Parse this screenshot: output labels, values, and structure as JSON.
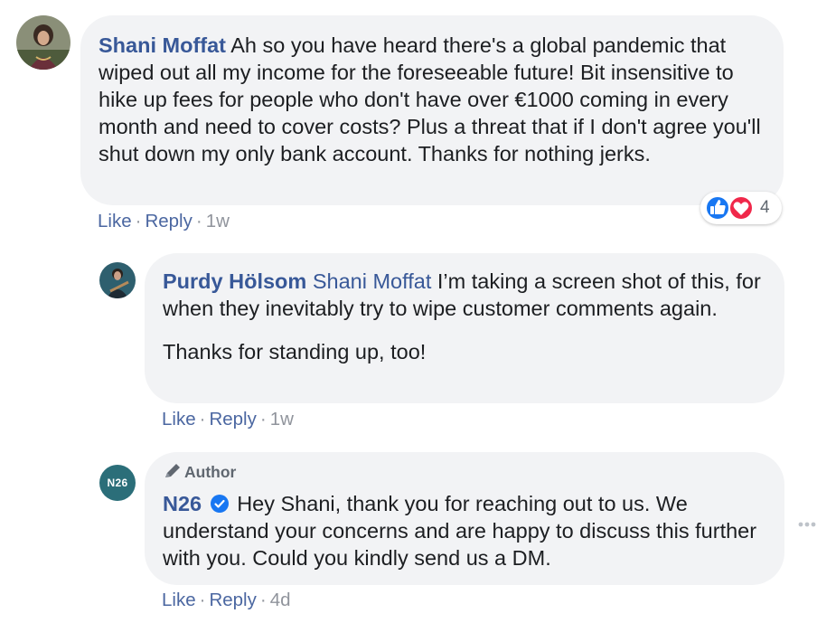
{
  "comments": [
    {
      "author": "Shani Moffat",
      "text": "Ah so you have heard there's a global pandemic that wiped out all my income for the foreseeable future! Bit insensitive to hike up fees for people who don't have over €1000 coming in every month and need to cover costs? Plus a threat that if I don't agree you'll shut down my only bank account. Thanks for nothing jerks.",
      "actions": {
        "like": "Like",
        "reply": "Reply",
        "time": "1w"
      },
      "reactions": {
        "count": "4",
        "types": [
          "like",
          "love"
        ]
      }
    },
    {
      "author": "Purdy Hölsom",
      "tag": "Shani Moffat",
      "text": "I’m taking a screen shot of this, for when they inevitably try to wipe customer comments again.",
      "text2": "Thanks for standing up, too!",
      "actions": {
        "like": "Like",
        "reply": "Reply",
        "time": "1w"
      }
    },
    {
      "author_badge": "Author",
      "author": "N26",
      "avatar_text": "N26",
      "text": "Hey Shani, thank you for reaching out to us. We understand your concerns and are happy to discuss this further with you. Could you kindly send us a DM.",
      "actions": {
        "like": "Like",
        "reply": "Reply",
        "time": "4d"
      }
    }
  ],
  "colors": {
    "link": "#385898",
    "action": "#4b67a1",
    "bubble": "#f2f3f5",
    "n26_teal": "#2b6e79",
    "verified": "#1877f2",
    "like": "#1877f2",
    "love": "#f0284a"
  }
}
